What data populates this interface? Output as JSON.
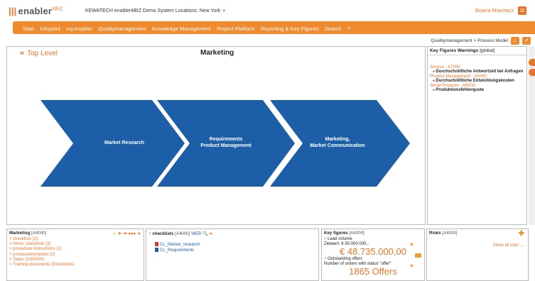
{
  "header": {
    "logo_prefix": "|||",
    "logo_text": "enabler",
    "logo_sup": "4BIZ",
    "company_text": "KEWATECH enabler4BIZ Demo System Locations:",
    "location": "New York",
    "user": "Bojana Mrachacz"
  },
  "nav": [
    "Start",
    "Infopoint",
    "my.enabler",
    "Qualitymanagement",
    "Knowledge Management",
    "Project Platform",
    "Reporting & Key Figures",
    "Search",
    "?"
  ],
  "breadcrumb": "Qualitymanagement > Process Model",
  "main": {
    "top_level": "Top Level",
    "title": "Marketing",
    "steps": [
      {
        "line1": "Market Research",
        "line2": ""
      },
      {
        "line1": "Requirements",
        "line2": "Product Management"
      },
      {
        "line1": "Marketing,",
        "line2": "Market Communication"
      }
    ],
    "accent_color": "#1c5fa8"
  },
  "key_figures_warnings": {
    "title": "Key Figures Warnings",
    "scope": "[global]",
    "groups": [
      {
        "category": "Service - A7000:",
        "items": [
          "Durchschnittliche Antwortzeit bei Anfragen"
        ]
      },
      {
        "category": "Product Management - A5000:",
        "items": [
          "Durchschnittliche Entwicklungskosten"
        ]
      },
      {
        "category": "Serial Products - A6000:",
        "items": [
          "Produktionsfehlerquote"
        ]
      }
    ]
  },
  "panel_marketing": {
    "title": "Marketing",
    "code": "[A4000]",
    "links": [
      "checklists (2)",
      "forms, checklists (3)",
      "procedure Instructions (2)",
      "processdescription (2)",
      "Tasks (1/3/0/0/0)",
      "Training documents (Directories)"
    ]
  },
  "panel_checklists": {
    "title": "checklists",
    "code": "[A4000]",
    "web": "WEB",
    "docs": [
      "CL_Market_research",
      "CL_Requirements"
    ]
  },
  "panel_keyfigures": {
    "title": "Key figures",
    "code": "[A4000]",
    "items": [
      {
        "name": "Lead volume",
        "desc": "Zielwert: € 50.000.000,-",
        "value": "€ 48.735.000,00"
      },
      {
        "name": "Outstanding offers",
        "desc": "Number of orders with status \"offer\"",
        "value": "1865 Offers"
      }
    ]
  },
  "panel_risks": {
    "title": "Risks",
    "code": "[A4000]",
    "show_all": "Show all risks ..."
  },
  "colors": {
    "brand": "#f08a2e",
    "accent": "#e8742a"
  }
}
